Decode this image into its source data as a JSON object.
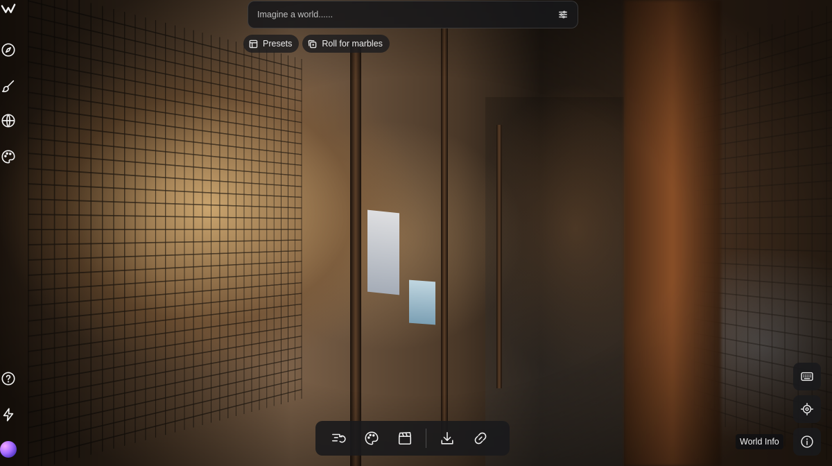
{
  "prompt": {
    "placeholder": "Imagine a world......",
    "value": ""
  },
  "chips": {
    "presets_label": "Presets",
    "roll_label": "Roll for marbles"
  },
  "rail": {
    "icons": [
      "logo-icon",
      "compass-icon",
      "brush-icon",
      "globe-icon",
      "palette-icon",
      "help-icon",
      "bolt-icon",
      "avatar"
    ]
  },
  "toolbar": {
    "icons": [
      "history-list-icon",
      "palette-icon",
      "clapperboard-icon",
      "download-icon",
      "link-icon"
    ]
  },
  "right_controls": {
    "icons": [
      "keyboard-icon",
      "crosshair-icon",
      "info-icon"
    ],
    "tooltip": "World Info"
  },
  "colors": {
    "panel": "#1a1a1c",
    "icon": "#f0f0f0",
    "avatar_gradient": [
      "#f4a8ff",
      "#a56bff",
      "#5a3cc9"
    ]
  }
}
